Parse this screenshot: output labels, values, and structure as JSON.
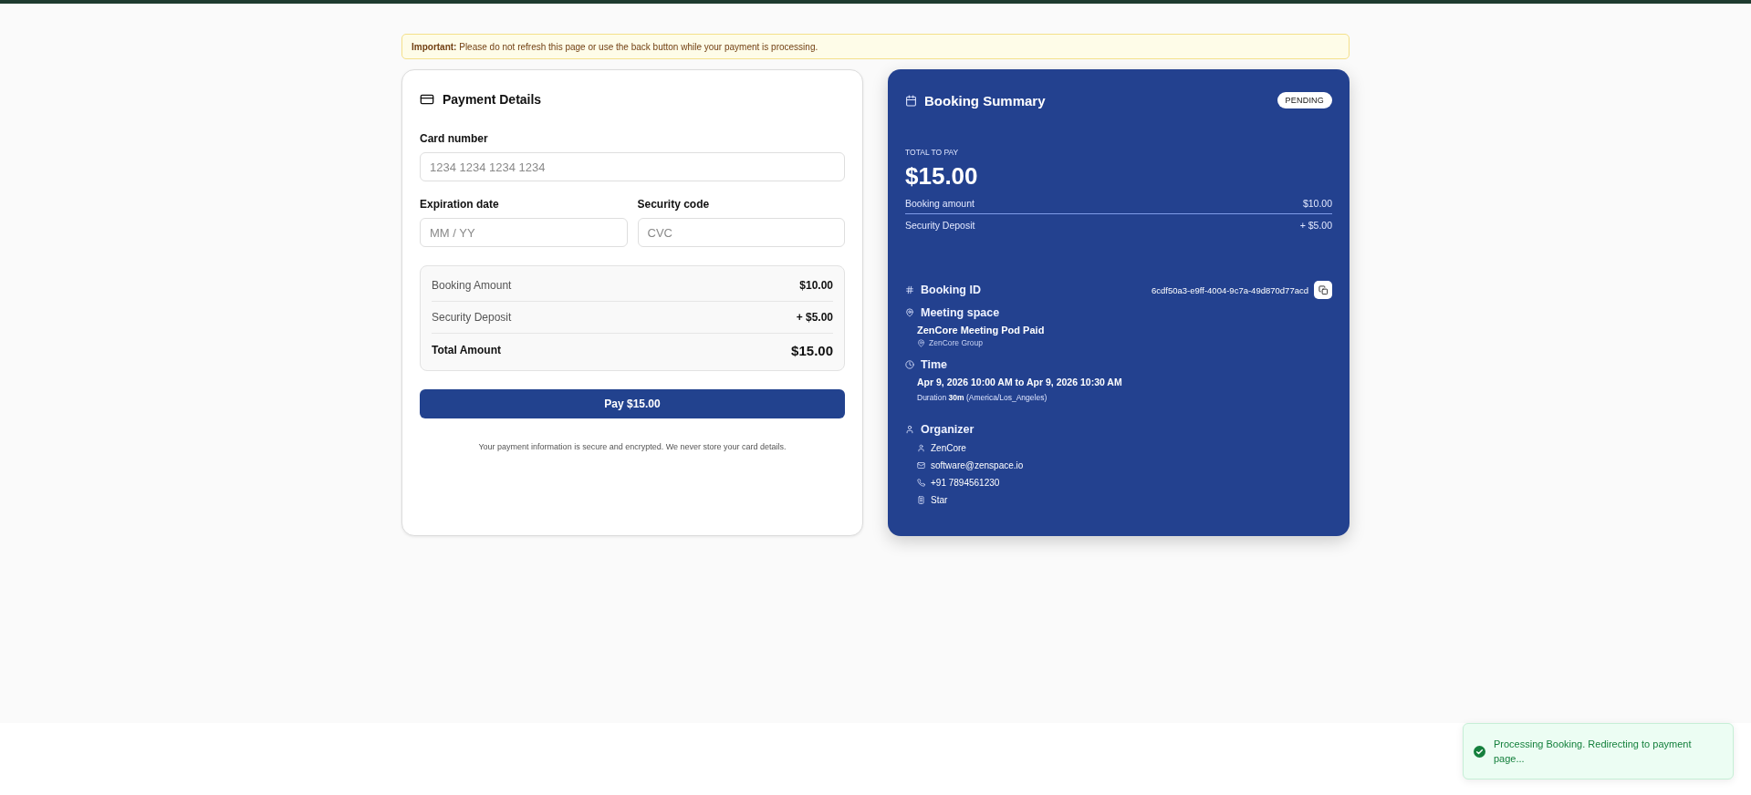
{
  "notice": {
    "text": "**Important:** Please do not refresh this page or use the back button while your payment is processing."
  },
  "payment": {
    "title": "Payment Details",
    "fields": [
      {
        "label": "Card number",
        "placeholder": "1234 1234 1234 1234"
      },
      {
        "label": "Expiration date",
        "placeholder": "MM / YY"
      },
      {
        "label": "Security code",
        "placeholder": "CVC"
      }
    ],
    "breakdown": [
      {
        "kind": "line",
        "label": "Booking Amount",
        "value": "$10.00"
      },
      {
        "kind": "line",
        "label": "Security Deposit",
        "value": "+ $5.00"
      },
      {
        "kind": "total",
        "label": "Total Amount",
        "value": "$15.00"
      }
    ],
    "pay_button": "Pay $15.00",
    "security_note": "Your payment information is secure and encrypted. We never store your card details."
  },
  "summary": {
    "title": "Booking Summary",
    "status": "PENDING",
    "total_label": "TOTAL TO PAY",
    "total": "$15.00",
    "lines": [
      {
        "label": "Booking amount",
        "value": "$10.00"
      },
      {
        "label": "Security Deposit",
        "value": "+ $5.00"
      }
    ],
    "booking_id": {
      "label": "Booking ID",
      "value": "6cdf50a3-e9ff-4004-9c7a-49d870d77acd"
    },
    "meeting_space": {
      "label": "Meeting space",
      "name": "ZenCore Meeting Pod Paid",
      "location": "ZenCore Group"
    },
    "time": {
      "label": "Time",
      "range": "Apr 9, 2026 10:00 AM to Apr 9, 2026 10:30 AM",
      "duration": "Duration **30m** (America/Los_Angeles)"
    },
    "organizer": {
      "label": "Organizer",
      "details": [
        {
          "kind": "person",
          "text": "ZenCore"
        },
        {
          "kind": "email",
          "text": "software@zenspace.io"
        },
        {
          "kind": "phone",
          "text": "+91 7894561230"
        },
        {
          "kind": "building",
          "text": "Star"
        }
      ]
    }
  },
  "toast": {
    "text": "Processing Booking. Redirecting to payment page..."
  }
}
